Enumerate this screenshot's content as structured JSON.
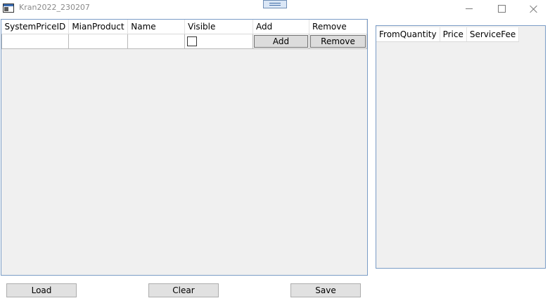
{
  "window": {
    "title": "Kran2022_230207",
    "icons": {
      "app": "app-icon",
      "minimize": "minimize-icon",
      "maximize": "maximize-icon",
      "close": "close-icon",
      "grip": "grip-icon"
    }
  },
  "main_grid": {
    "columns": [
      "SystemPriceID",
      "MianProduct",
      "Name",
      "Visible",
      "Add",
      "Remove"
    ],
    "row": {
      "system_price_id": "",
      "main_product": "",
      "name": "",
      "visible_checked": false,
      "add_label": "Add",
      "remove_label": "Remove"
    }
  },
  "side_grid": {
    "columns": [
      "FromQuantity",
      "Price",
      "ServiceFee"
    ]
  },
  "buttons": {
    "load": "Load",
    "clear": "Clear",
    "save": "Save"
  },
  "colors": {
    "grid_border": "#7a9cc6",
    "grid_background": "#f0f0f0",
    "button_background": "#e1e1e1"
  }
}
